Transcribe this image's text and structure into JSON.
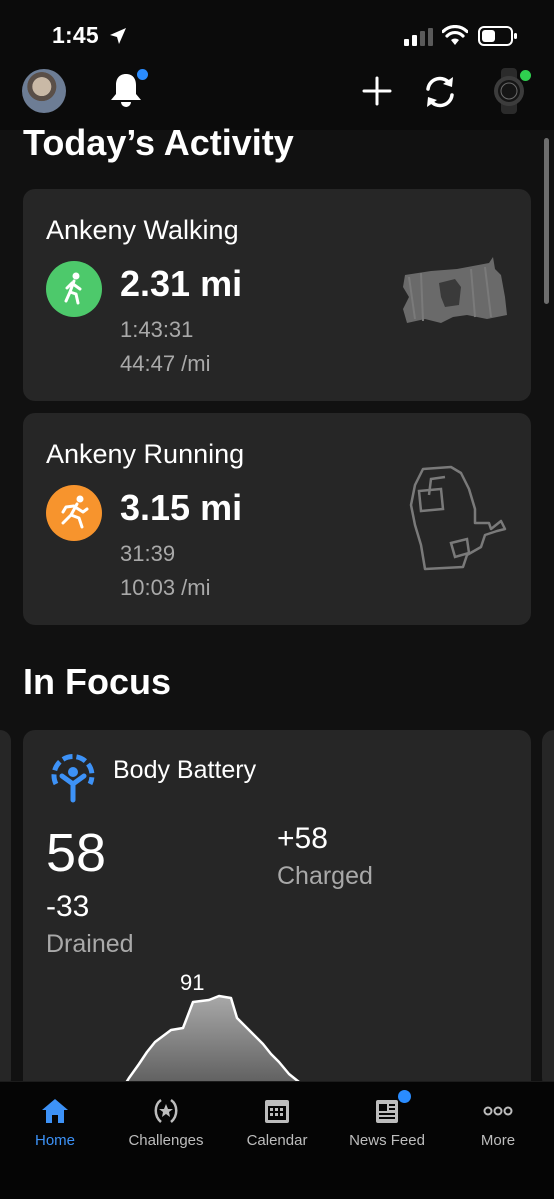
{
  "status_bar": {
    "time": "1:45"
  },
  "header": {
    "icons": [
      "avatar",
      "bell-icon",
      "plus-icon",
      "sync-icon",
      "watch-icon"
    ],
    "notification_dot_color": "#2a8cff",
    "device_connected_color": "#2fd04f"
  },
  "today": {
    "title": "Today’s Activity",
    "activities": [
      {
        "name": "Ankeny Walking",
        "distance": "2.31 mi",
        "duration": "1:43:31",
        "pace": "44:47 /mi",
        "icon": "walking-icon",
        "icon_color": "#4dc96b"
      },
      {
        "name": "Ankeny Running",
        "distance": "3.15 mi",
        "duration": "31:39",
        "pace": "10:03 /mi",
        "icon": "running-icon",
        "icon_color": "#f7942d"
      }
    ]
  },
  "in_focus": {
    "title": "In Focus",
    "body_battery": {
      "title": "Body Battery",
      "value": "58",
      "drained_value": "-33",
      "drained_label": "Drained",
      "charged_value": "+58",
      "charged_label": "Charged",
      "peak_label": "91",
      "accent_color": "#3d92f7"
    }
  },
  "tab_bar": {
    "tabs": [
      {
        "label": "Home",
        "icon": "home-icon",
        "active": true
      },
      {
        "label": "Challenges",
        "icon": "laurel-icon",
        "active": false
      },
      {
        "label": "Calendar",
        "icon": "calendar-icon",
        "active": false
      },
      {
        "label": "News Feed",
        "icon": "news-icon",
        "active": false
      },
      {
        "label": "More",
        "icon": "more-icon",
        "active": false
      }
    ],
    "active_color": "#3d92f7"
  }
}
